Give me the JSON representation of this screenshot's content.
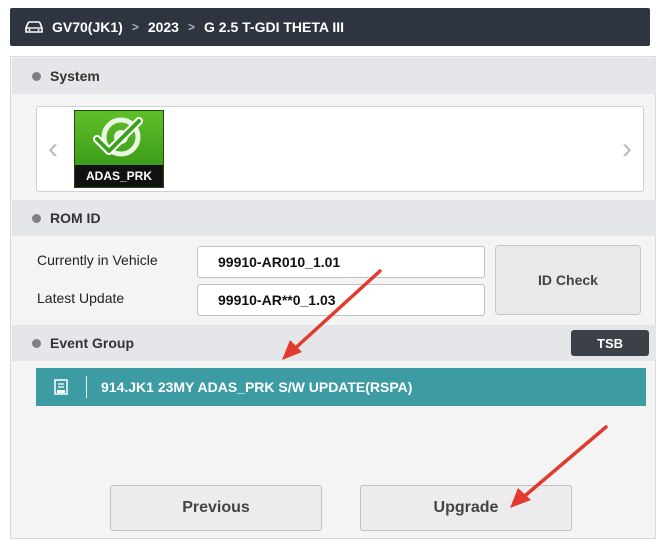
{
  "breadcrumb": {
    "icon": "car-icon",
    "model": "GV70(JK1)",
    "year": "2023",
    "engine": "G 2.5 T-GDI THETA III"
  },
  "system": {
    "title": "System",
    "tile_label": "ADAS_PRK",
    "tile_icon": "adas-check-icon"
  },
  "rom": {
    "title": "ROM ID",
    "current_label": "Currently in Vehicle",
    "current_value": "99910-AR010_1.01",
    "latest_label": "Latest Update",
    "latest_value": "99910-AR**0_1.03",
    "check_button": "ID Check"
  },
  "event_group": {
    "title": "Event Group",
    "tsb_button": "TSB",
    "item_text": "914.JK1 23MY ADAS_PRK S/W UPDATE(RSPA)",
    "item_icon": "document-icon"
  },
  "footer": {
    "previous_button": "Previous",
    "upgrade_button": "Upgrade"
  },
  "colors": {
    "header_bg": "#2f3540",
    "event_row_bg": "#3c9ba3",
    "annotation_arrow": "#e03b2e"
  }
}
